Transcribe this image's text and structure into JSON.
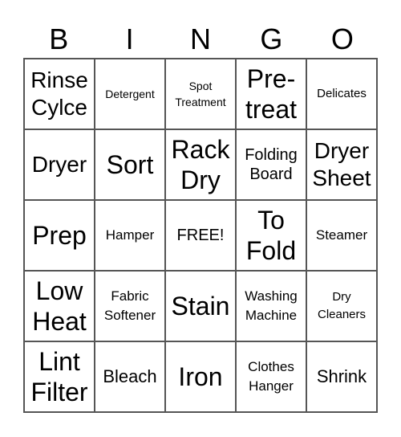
{
  "header": {
    "letters": [
      "B",
      "I",
      "N",
      "G",
      "O"
    ]
  },
  "grid": {
    "rows": [
      [
        "Rinse Cylce",
        "Detergent",
        "Spot Treatment",
        "Pre-treat",
        "Delicates"
      ],
      [
        "Dryer",
        "Sort",
        "Rack Dry",
        "Folding Board",
        "Dryer Sheet"
      ],
      [
        "Prep",
        "Hamper",
        "FREE!",
        "To Fold",
        "Steamer"
      ],
      [
        "Low Heat",
        "Fabric Softener",
        "Stain",
        "Washing Machine",
        "Dry Cleaners"
      ],
      [
        "Lint Filter",
        "Bleach",
        "Iron",
        "Clothes Hanger",
        "Shrink"
      ]
    ],
    "free_space": "FREE!"
  }
}
